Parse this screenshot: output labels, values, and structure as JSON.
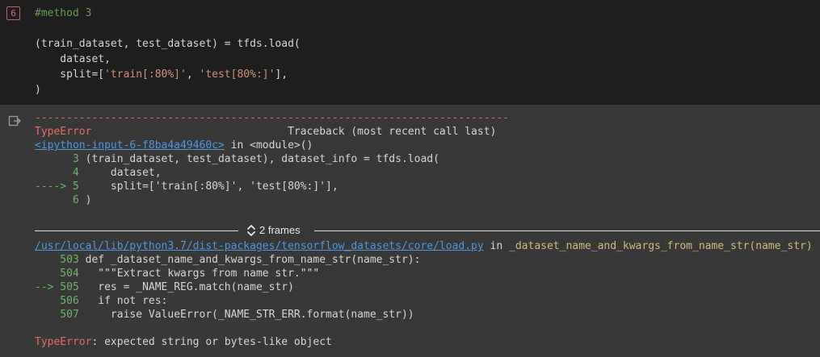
{
  "cell": {
    "execution_count": "6",
    "lines": {
      "l1": "#method 3",
      "l3a": "(train_dataset, test_dataset) = tfds.load(",
      "l4": "    dataset,",
      "l5a": "    split=[",
      "l5s1": "'train[:80%]'",
      "l5sep": ", ",
      "l5s2": "'test[80%:]'",
      "l5b": "],",
      "l6": ")"
    }
  },
  "output": {
    "separator": "---------------------------------------------------------------------------",
    "error_name": "TypeError",
    "traceback_header": "                               Traceback (most recent call last)",
    "frame1": {
      "link": "<ipython-input-6-f8ba4a49460c>",
      "location": " in <module>()",
      "lines": [
        {
          "prefix": "      3 ",
          "code": "(train_dataset, test_dataset), dataset_info = tfds.load("
        },
        {
          "prefix": "      4 ",
          "code": "    dataset,"
        },
        {
          "prefix": "----> 5 ",
          "code": "    split=['train[:80%]', 'test[80%:]'],"
        },
        {
          "prefix": "      6 ",
          "code": ")"
        }
      ]
    },
    "frames_toggle": "2 frames",
    "frame2": {
      "link": "/usr/local/lib/python3.7/dist-packages/tensorflow_datasets/core/load.py",
      "in_text": " in ",
      "func": "_dataset_name_and_kwargs_from_name_str(name_str)",
      "lines": [
        {
          "prefix": "    503 ",
          "code": "def _dataset_name_and_kwargs_from_name_str(name_str):"
        },
        {
          "prefix": "    504 ",
          "code": "  \"\"\"Extract kwargs from name str.\"\"\""
        },
        {
          "prefix": "--> 505 ",
          "code": "  res = _NAME_REG.match(name_str)"
        },
        {
          "prefix": "    506 ",
          "code": "  if not res:"
        },
        {
          "prefix": "    507 ",
          "code": "    raise ValueError(_NAME_STR_ERR.format(name_str))"
        }
      ]
    },
    "final_error": {
      "name": "TypeError",
      "message": ": expected string or bytes-like object"
    }
  },
  "colors": {
    "cell_bg": "#1e1e1e",
    "output_bg": "#383838",
    "error_red": "#e06c60",
    "link_blue": "#4e95e0",
    "arrow_green": "#6bb36b"
  },
  "icons": {
    "output_icon": "output-redirect-icon",
    "frames_icon": "unfold-chevrons-icon"
  }
}
